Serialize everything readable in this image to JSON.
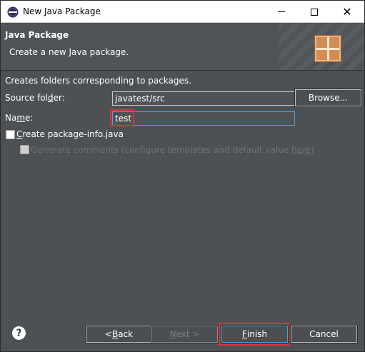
{
  "window": {
    "title": "New Java Package",
    "app_icon": "eclipse-icon"
  },
  "banner": {
    "title": "Java Package",
    "description": "Create a new Java package.",
    "icon": "package-wizard-icon"
  },
  "form": {
    "description": "Creates folders corresponding to packages.",
    "source_folder": {
      "label": "Source folder:",
      "value": "javatest/src",
      "browse_label": "Browse..."
    },
    "name": {
      "label": "Name:",
      "value": "test"
    },
    "create_package_info": {
      "label": "Create package-info.java",
      "checked": false
    },
    "generate_comments": {
      "label_prefix": "Generate comments (configure templates and default value ",
      "link": "here",
      "label_suffix": ")",
      "enabled": false
    }
  },
  "footer": {
    "help_icon": "help-icon",
    "back_label": "< Back",
    "next_label": "Next >",
    "finish_label": "Finish",
    "cancel_label": "Cancel"
  },
  "colors": {
    "background": "#4d5153",
    "highlight": "#e0303a",
    "focus": "#4aa3df"
  }
}
